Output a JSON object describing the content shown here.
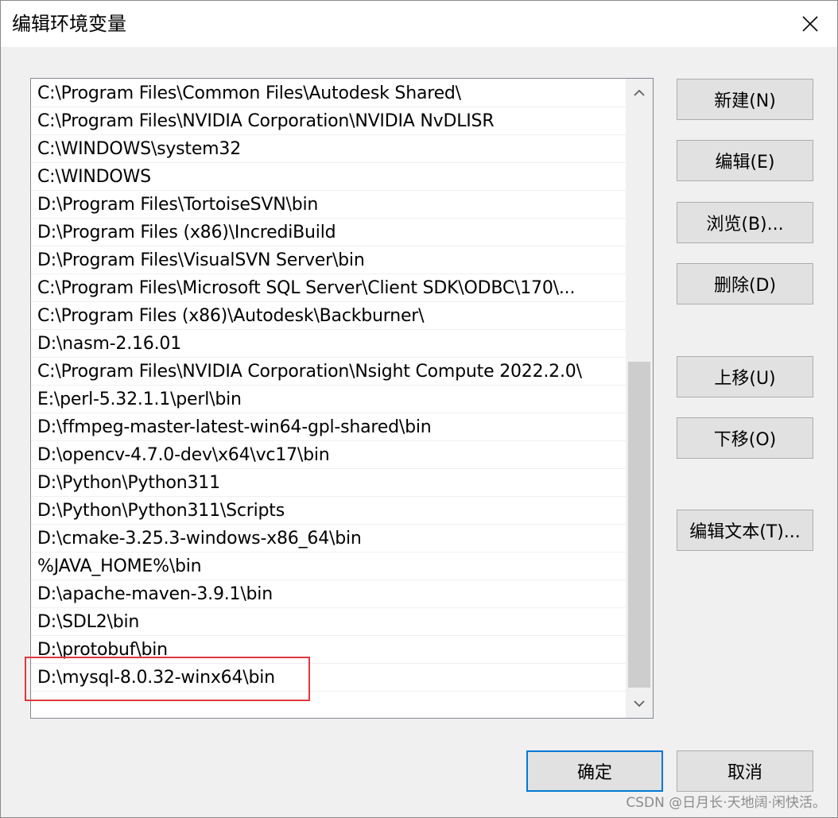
{
  "window": {
    "title": "编辑环境变量",
    "close_icon": "close-icon"
  },
  "path_list": {
    "items": [
      "C:\\Program Files\\Common Files\\Autodesk Shared\\",
      "C:\\Program Files\\NVIDIA Corporation\\NVIDIA NvDLISR",
      "C:\\WINDOWS\\system32",
      "C:\\WINDOWS",
      "D:\\Program Files\\TortoiseSVN\\bin",
      "D:\\Program Files (x86)\\IncrediBuild",
      "D:\\Program Files\\VisualSVN Server\\bin",
      "C:\\Program Files\\Microsoft SQL Server\\Client SDK\\ODBC\\170\\...",
      "C:\\Program Files (x86)\\Autodesk\\Backburner\\",
      "D:\\nasm-2.16.01",
      "C:\\Program Files\\NVIDIA Corporation\\Nsight Compute 2022.2.0\\",
      "E:\\perl-5.32.1.1\\perl\\bin",
      "D:\\ffmpeg-master-latest-win64-gpl-shared\\bin",
      "D:\\opencv-4.7.0-dev\\x64\\vc17\\bin",
      "D:\\Python\\Python311",
      "D:\\Python\\Python311\\Scripts",
      "D:\\cmake-3.25.3-windows-x86_64\\bin",
      "%JAVA_HOME%\\bin",
      "D:\\apache-maven-3.9.1\\bin",
      "D:\\SDL2\\bin",
      "D:\\protobuf\\bin",
      "D:\\mysql-8.0.32-winx64\\bin"
    ],
    "highlighted_item": "D:\\mysql-8.0.32-winx64\\bin",
    "highlight_color": "#e0383e"
  },
  "buttons": {
    "new": "新建(N)",
    "edit": "编辑(E)",
    "browse": "浏览(B)...",
    "delete": "删除(D)",
    "move_up": "上移(U)",
    "move_down": "下移(O)",
    "edit_text": "编辑文本(T)...",
    "ok": "确定",
    "cancel": "取消"
  },
  "watermark": "CSDN @日月长·天地阔·闲快活。",
  "colors": {
    "accent": "#0078d7",
    "dialog_bg": "#f0f0f0",
    "button_bg": "#e1e1e1"
  }
}
